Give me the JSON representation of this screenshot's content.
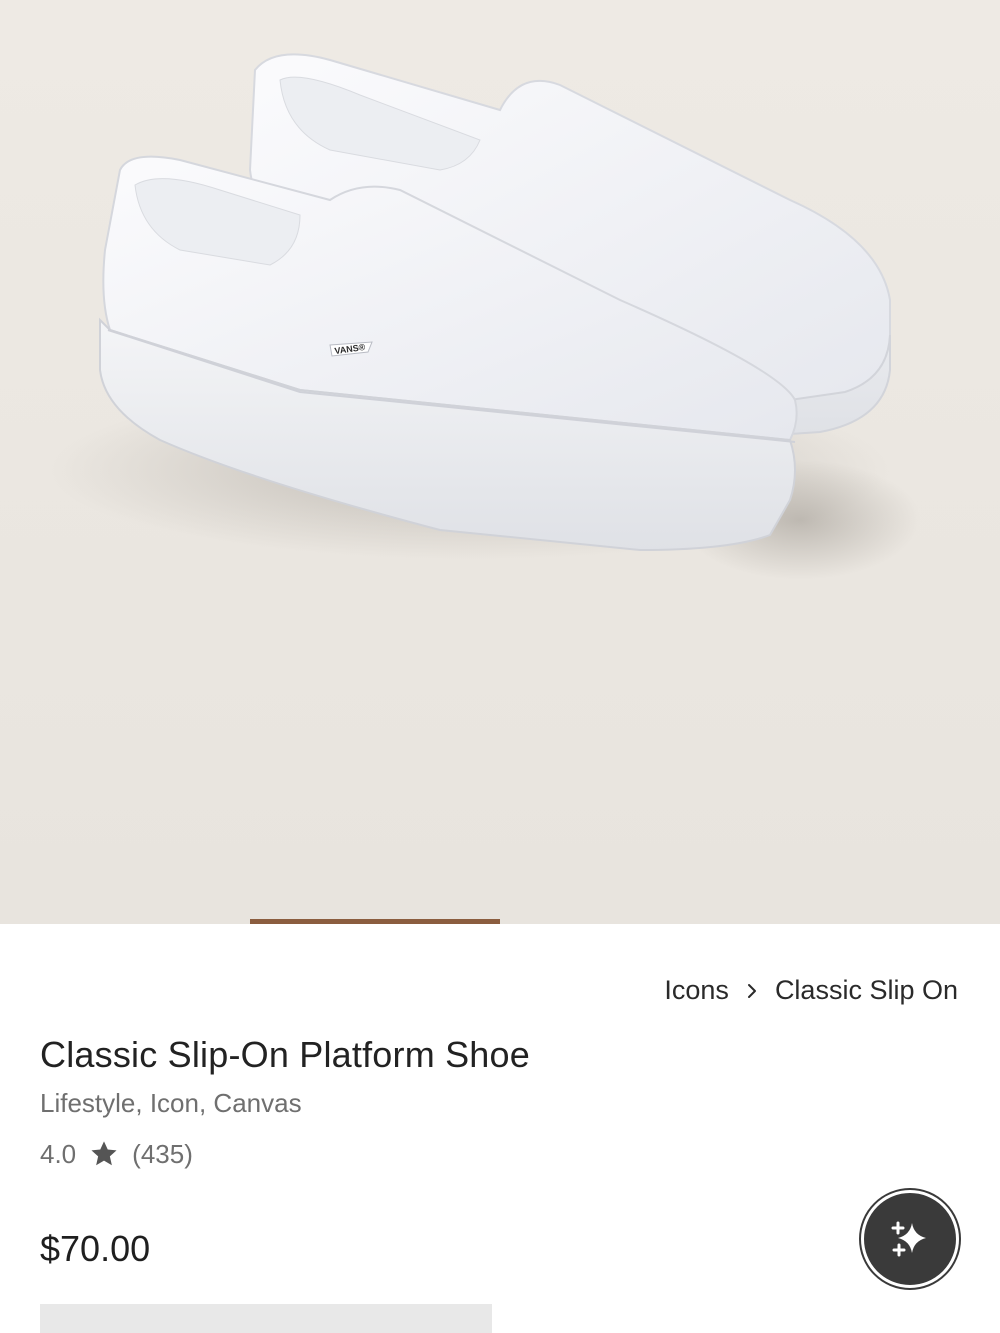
{
  "breadcrumb": {
    "items": [
      "Icons",
      "Classic Slip On"
    ]
  },
  "product": {
    "title": "Classic Slip-On Platform Shoe",
    "subtitle": "Lifestyle, Icon, Canvas",
    "rating": "4.0",
    "review_count": "(435)",
    "price": "$70.00",
    "image_logo_text": "VANS®"
  },
  "carousel": {
    "active_index": 1,
    "total": 4
  },
  "icons": {
    "rating_star": "star-icon",
    "breadcrumb_separator": "chevron-right-icon",
    "assistant": "sparkle-icon"
  },
  "colors": {
    "hero_background": "#ebe7e1",
    "carousel_indicator": "#8b5d3f",
    "assistant_button": "#3a3a3a"
  }
}
